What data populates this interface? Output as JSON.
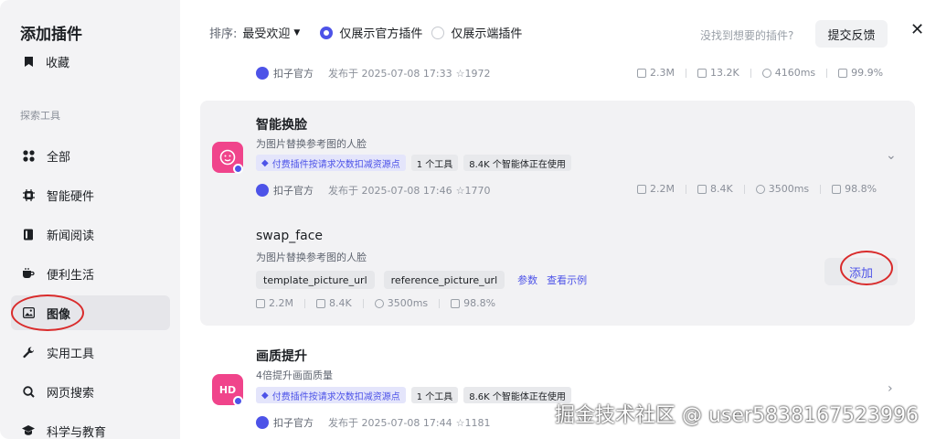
{
  "sidebar": {
    "title": "添加插件",
    "favorites": "收藏",
    "section": "探索工具",
    "items": [
      {
        "label": "全部",
        "icon": "grid-icon"
      },
      {
        "label": "智能硬件",
        "icon": "chip-icon"
      },
      {
        "label": "新闻阅读",
        "icon": "book-icon"
      },
      {
        "label": "便利生活",
        "icon": "coffee-icon"
      },
      {
        "label": "图像",
        "icon": "image-icon",
        "active": true
      },
      {
        "label": "实用工具",
        "icon": "wrench-icon"
      },
      {
        "label": "网页搜索",
        "icon": "search-icon"
      },
      {
        "label": "科学与教育",
        "icon": "graduation-icon"
      }
    ]
  },
  "filter": {
    "sort_label": "排序:",
    "sort_value": "最受欢迎",
    "opt_official": "仅展示官方插件",
    "opt_client": "仅展示端插件",
    "not_found": "没找到想要的插件?",
    "feedback": "提交反馈"
  },
  "prev_card": {
    "author": "扣子官方",
    "published": "发布于 2025-07-08 17:33",
    "stars": "1972",
    "stats": [
      "2.3M",
      "13.2K",
      "4160ms",
      "99.9%"
    ]
  },
  "face_card": {
    "title": "智能换脸",
    "desc": "为图片替换参考图的人脸",
    "paid_tag": "付费插件按请求次数扣减资源点",
    "tools_tag": "1 个工具",
    "usage_tag": "8.4K 个智能体正在使用",
    "author": "扣子官方",
    "published": "发布于 2025-07-08 17:46",
    "stars": "1770",
    "stats": [
      "2.2M",
      "8.4K",
      "3500ms",
      "98.8%"
    ],
    "tool": {
      "name": "swap_face",
      "desc": "为图片替换参考图的人脸",
      "params": [
        "template_picture_url",
        "reference_picture_url"
      ],
      "params_link": "参数",
      "example_link": "查看示例",
      "stats": [
        "2.2M",
        "8.4K",
        "3500ms",
        "98.8%"
      ],
      "add": "添加"
    }
  },
  "hd_card": {
    "title": "画质提升",
    "desc": "4倍提升画面质量",
    "icon_text": "HD",
    "paid_tag": "付费插件按请求次数扣减资源点",
    "tools_tag": "1 个工具",
    "usage_tag": "8.6K 个智能体正在使用",
    "author": "扣子官方",
    "published": "发布于 2025-07-08 17:44",
    "stars": "1181"
  },
  "watermark": "掘金技术社区 @ user5838167523996",
  "colors": {
    "accent": "#4d53e8",
    "pink": "#f0448b",
    "annotation": "#d92b2b"
  }
}
